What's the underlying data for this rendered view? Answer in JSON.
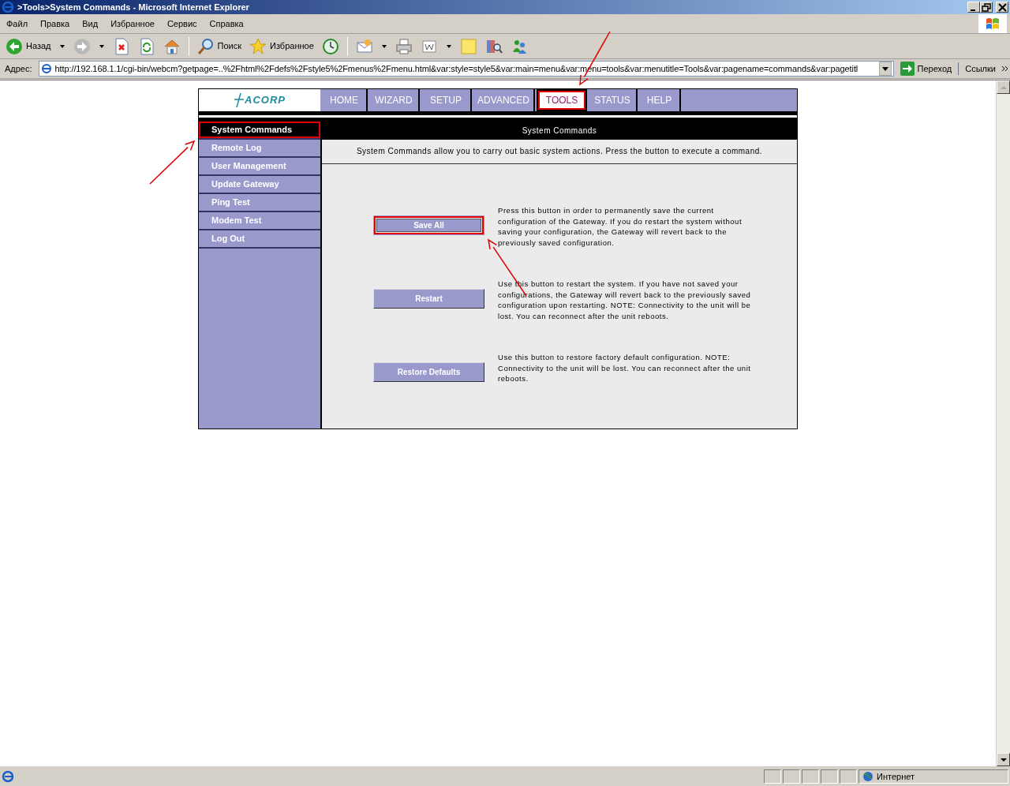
{
  "window": {
    "title": ">Tools>System Commands - Microsoft Internet Explorer"
  },
  "menu_bar": [
    "Файл",
    "Правка",
    "Вид",
    "Избранное",
    "Сервис",
    "Справка"
  ],
  "toolbar": [
    {
      "kind": "back",
      "label": "Назад"
    },
    {
      "kind": "forward"
    },
    {
      "kind": "stop"
    },
    {
      "kind": "refresh"
    },
    {
      "kind": "home"
    },
    {
      "kind": "search",
      "label": "Поиск"
    },
    {
      "kind": "favorites",
      "label": "Избранное"
    },
    {
      "kind": "history"
    },
    {
      "kind": "mail"
    },
    {
      "kind": "print"
    },
    {
      "kind": "edit"
    },
    {
      "kind": "notes"
    },
    {
      "kind": "research"
    },
    {
      "kind": "messenger"
    }
  ],
  "address_bar": {
    "label": "Адрес:",
    "value": "http://192.168.1.1/cgi-bin/webcm?getpage=..%2Fhtml%2Fdefs%2Fstyle5%2Fmenus%2Fmenu.html&var:style=style5&var:main=menu&var:menu=tools&var:menutitle=Tools&var:pagename=commands&var:pagetitl",
    "go_button": "Переход",
    "links": "Ссылки"
  },
  "page": {
    "logo": "ACORP",
    "tabs": [
      {
        "label": "HOME",
        "selected": false,
        "highlighted": false
      },
      {
        "label": "WIZARD",
        "selected": false,
        "highlighted": false
      },
      {
        "label": "SETUP",
        "selected": false,
        "highlighted": false
      },
      {
        "label": "ADVANCED",
        "selected": false,
        "highlighted": false
      },
      {
        "label": "TOOLS",
        "selected": true,
        "highlighted": true
      },
      {
        "label": "STATUS",
        "selected": false,
        "highlighted": false
      },
      {
        "label": "HELP",
        "selected": false,
        "highlighted": false
      }
    ],
    "sidebar": [
      {
        "label": "System Commands",
        "selected": true,
        "highlighted": true
      },
      {
        "label": "Remote Log",
        "selected": false,
        "highlighted": false
      },
      {
        "label": "User Management",
        "selected": false,
        "highlighted": false
      },
      {
        "label": "Update Gateway",
        "selected": false,
        "highlighted": false
      },
      {
        "label": "Ping Test",
        "selected": false,
        "highlighted": false
      },
      {
        "label": "Modem Test",
        "selected": false,
        "highlighted": false
      },
      {
        "label": "Log Out",
        "selected": false,
        "highlighted": false
      }
    ],
    "section_title": "System Commands",
    "description": "System Commands allow you to carry out basic system actions. Press the button to execute a command.",
    "commands": [
      {
        "button": "Save All",
        "highlighted": true,
        "text": "Press this button in order to permanently save the current configuration of the Gateway. If you do restart the system without saving your configuration, the Gateway will revert back to the previously saved configuration."
      },
      {
        "button": "Restart",
        "highlighted": false,
        "text": "Use this button to restart the system. If you have not saved your configurations, the Gateway will revert back to the previously saved configuration upon restarting. NOTE: Connectivity to the unit will be lost. You can reconnect after the unit reboots."
      },
      {
        "button": "Restore Defaults",
        "highlighted": false,
        "text": "Use this button to restore factory default configuration. NOTE: Connectivity to the unit will be lost. You can reconnect after the unit reboots."
      }
    ]
  },
  "status_bar": {
    "zone": "Интернет"
  }
}
